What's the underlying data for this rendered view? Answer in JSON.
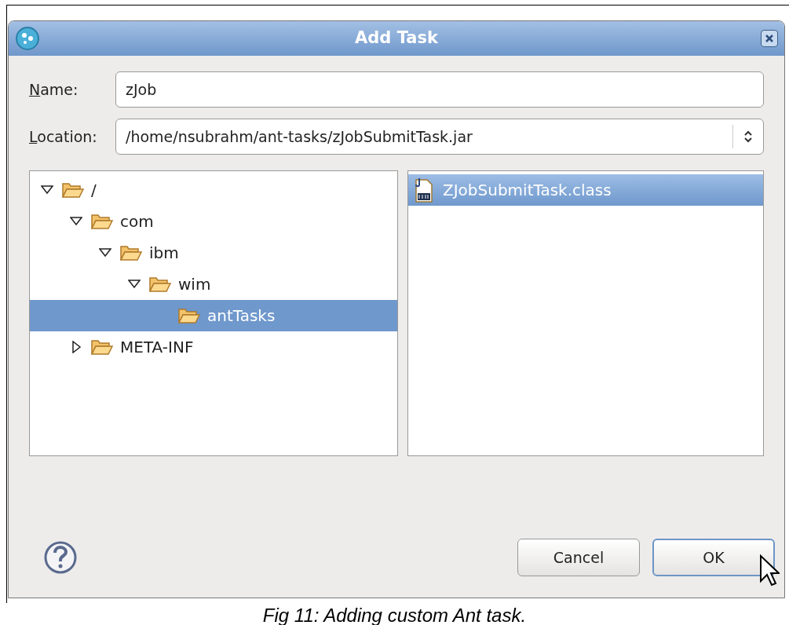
{
  "window": {
    "title": "Add Task"
  },
  "fields": [
    {
      "kind": "text",
      "label": "Name:",
      "value": "zJob"
    },
    {
      "kind": "combo",
      "label": "Location:",
      "value": "/home/nsubrahm/ant-tasks/zJobSubmitTask.jar"
    }
  ],
  "tree": [
    {
      "label": "/",
      "expanded": true,
      "selected": false,
      "children": [
        {
          "label": "com",
          "expanded": true,
          "selected": false,
          "children": [
            {
              "label": "ibm",
              "expanded": true,
              "selected": false,
              "children": [
                {
                  "label": "wim",
                  "expanded": true,
                  "selected": false,
                  "children": [
                    {
                      "label": "antTasks",
                      "selected": true
                    }
                  ]
                }
              ]
            }
          ]
        },
        {
          "label": "META-INF",
          "expanded": false,
          "selected": false
        }
      ]
    }
  ],
  "classes": [
    {
      "label": "ZJobSubmitTask.class",
      "selected": true
    }
  ],
  "buttons": [
    {
      "label": "Cancel",
      "default": false
    },
    {
      "label": "OK",
      "default": true
    }
  ],
  "caption": "Fig 11: Adding custom Ant task."
}
